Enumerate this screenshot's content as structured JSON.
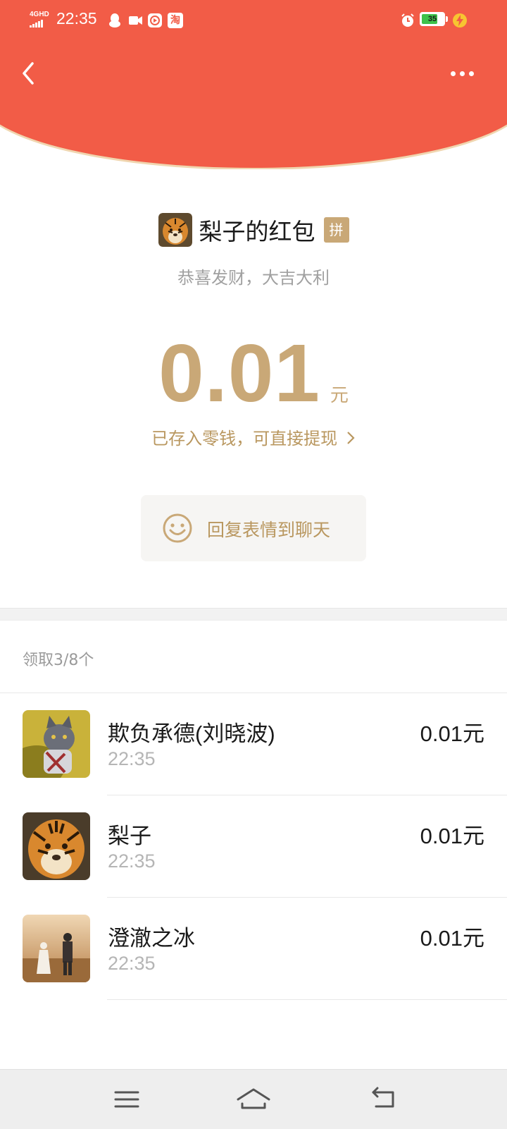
{
  "status_bar": {
    "network": "4GHD",
    "time": "22:35",
    "battery": "35",
    "icons": [
      "qq-icon",
      "video-icon",
      "play-icon",
      "taobao-icon",
      "alarm-icon",
      "battery-icon",
      "charging-icon"
    ],
    "taobao_glyph": "淘"
  },
  "header": {
    "background_color": "#f25c47",
    "back_icon": "chevron-left-icon",
    "more_icon": "more-dots-icon"
  },
  "packet": {
    "title": "梨子的红包",
    "badge": "拼",
    "greeting": "恭喜发财，大吉大利",
    "amount": "0.01",
    "unit": "元",
    "saved_text": "已存入零钱，可直接提现",
    "reply_label": "回复表情到聊天",
    "accent_color": "#c9a877"
  },
  "claims": {
    "summary": "领取3/8个",
    "items": [
      {
        "name": "欺负承德(刘晓波)",
        "time": "22:35",
        "amount": "0.01元",
        "avatar": "cat-avatar"
      },
      {
        "name": "梨子",
        "time": "22:35",
        "amount": "0.01元",
        "avatar": "tiger-avatar"
      },
      {
        "name": "澄澈之冰",
        "time": "22:35",
        "amount": "0.01元",
        "avatar": "couple-avatar"
      }
    ]
  },
  "nav_bar": {
    "buttons": [
      "menu-icon",
      "home-icon",
      "back-icon"
    ]
  }
}
